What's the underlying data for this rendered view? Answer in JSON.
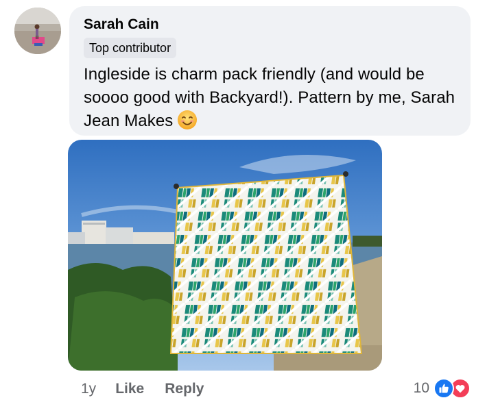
{
  "comment": {
    "author": "Sarah Cain",
    "badge": "Top contributor",
    "text": "Ingleside is charm pack friendly (and would be soooo good with Backyard!). Pattern by me, Sarah Jean Makes",
    "emoji": "smiling-face-icon"
  },
  "footer": {
    "time": "1y",
    "like_label": "Like",
    "reply_label": "Reply",
    "reaction_count": "10",
    "reaction_icons": [
      "like-reaction-icon",
      "love-reaction-icon"
    ]
  },
  "colors": {
    "bubble": "#f0f2f5",
    "muted_text": "#65676b",
    "like_blue": "#1877f2",
    "love_red": "#f33e58",
    "quilt_teal": "#1b8a7a",
    "quilt_yellow": "#e8c64a"
  }
}
